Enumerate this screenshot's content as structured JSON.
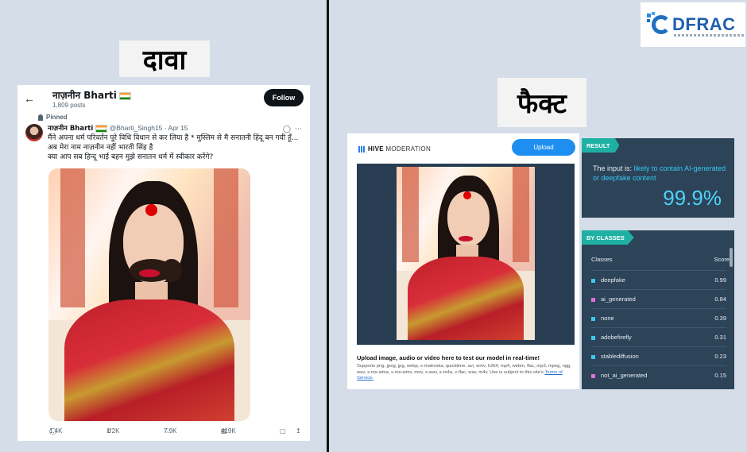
{
  "labels": {
    "claim": "दावा",
    "fact": "फैक्ट"
  },
  "logo": {
    "text": "DFRAC"
  },
  "tweet": {
    "profile_name": "नाज़नीन Bharti",
    "posts_count": "1,809 posts",
    "follow_label": "Follow",
    "pinned_label": "Pinned",
    "author": "नाज़नीन Bharti",
    "handle_date": "@Bharti_Singh15 · Apr 15",
    "text_line1": "मैंने अपना धर्म परिवर्तन पूरे विधि विधान से कर लिया है * मुस्लिम से मै सनातनी हिंदू बन गयी हूँ... अब मेरा नाम नाज़नीन नहीं भारती सिंह है",
    "text_line2": "क्या आप सब हिन्दू भाई बहन मुझे सनातन धर्म में स्वीकार करेंगे?",
    "replies": "1.4K",
    "reposts": "1.2K",
    "likes": "7.9K",
    "views": "419K"
  },
  "hive": {
    "brand_strong": "HIVE",
    "brand_rest": " MODERATION",
    "upload_label": "Upload",
    "info_title": "Upload image, audio or video here to test our model in real-time!",
    "info_text": "Supports png, jpeg, jpg, webp, x-matroska, quicktime, avi, wmv, h264, mp4, webm, flac, mp3, mpeg, ogg, wav, x-ms-wma, x-ms-wmv, mov, x-wav, x-m4a, x-flac, wav, m4v. Use is subject to this site's ",
    "info_link": "Terms of Service."
  },
  "result": {
    "tag": "RESULT",
    "prefix": "The input is: ",
    "verdict": "likely to contain AI-generated or deepfake content",
    "percent": "99.9%"
  },
  "classes": {
    "tag": "BY CLASSES",
    "col_classes": "Classes",
    "col_score": "Score",
    "rows": [
      {
        "name": "deepfake",
        "score": "0.99",
        "color": "#3ec8f0"
      },
      {
        "name": "ai_generated",
        "score": "0.84",
        "color": "#e070d8"
      },
      {
        "name": "none",
        "score": "0.39",
        "color": "#3ec8f0"
      },
      {
        "name": "adobefirefly",
        "score": "0.31",
        "color": "#3ec8f0"
      },
      {
        "name": "stablediffusion",
        "score": "0.23",
        "color": "#3ec8f0"
      },
      {
        "name": "not_ai_generated",
        "score": "0.15",
        "color": "#e070d8"
      }
    ]
  }
}
